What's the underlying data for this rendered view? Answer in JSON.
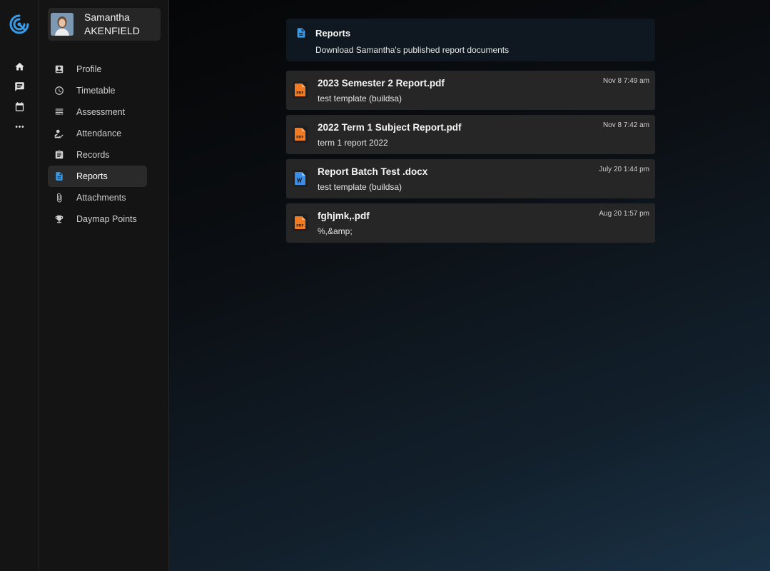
{
  "rail": {
    "items": [
      {
        "icon": "home-icon"
      },
      {
        "icon": "chat-icon"
      },
      {
        "icon": "calendar-icon"
      },
      {
        "icon": "more-icon"
      }
    ]
  },
  "student": {
    "first_name": "Samantha",
    "last_name": "AKENFIELD"
  },
  "sidebar": {
    "items": [
      {
        "label": "Profile",
        "icon": "profile-icon"
      },
      {
        "label": "Timetable",
        "icon": "clock-icon"
      },
      {
        "label": "Assessment",
        "icon": "assessment-icon"
      },
      {
        "label": "Attendance",
        "icon": "attendance-icon"
      },
      {
        "label": "Records",
        "icon": "clipboard-icon"
      },
      {
        "label": "Reports",
        "icon": "document-icon",
        "active": true
      },
      {
        "label": "Attachments",
        "icon": "paperclip-icon"
      },
      {
        "label": "Daymap Points",
        "icon": "trophy-icon"
      }
    ]
  },
  "header": {
    "title": "Reports",
    "subtitle": "Download Samantha's published report documents"
  },
  "files": [
    {
      "name": "2023 Semester 2 Report.pdf",
      "desc": "test template (buildsa)",
      "date": "Nov 8 7:49 am",
      "type": "pdf"
    },
    {
      "name": "2022 Term 1 Subject Report.pdf",
      "desc": "term 1 report 2022",
      "date": "Nov 8 7:42 am",
      "type": "pdf"
    },
    {
      "name": "Report Batch Test .docx",
      "desc": "test template (buildsa)",
      "date": "July 20 1:44 pm",
      "type": "docx"
    },
    {
      "name": "fghjmk,.pdf",
      "desc": "%,&amp;",
      "date": "Aug 20 1:57 pm",
      "type": "pdf"
    }
  ],
  "colors": {
    "accent": "#3b9ae6",
    "pdf": "#f07b22",
    "word": "#3b8de6"
  }
}
